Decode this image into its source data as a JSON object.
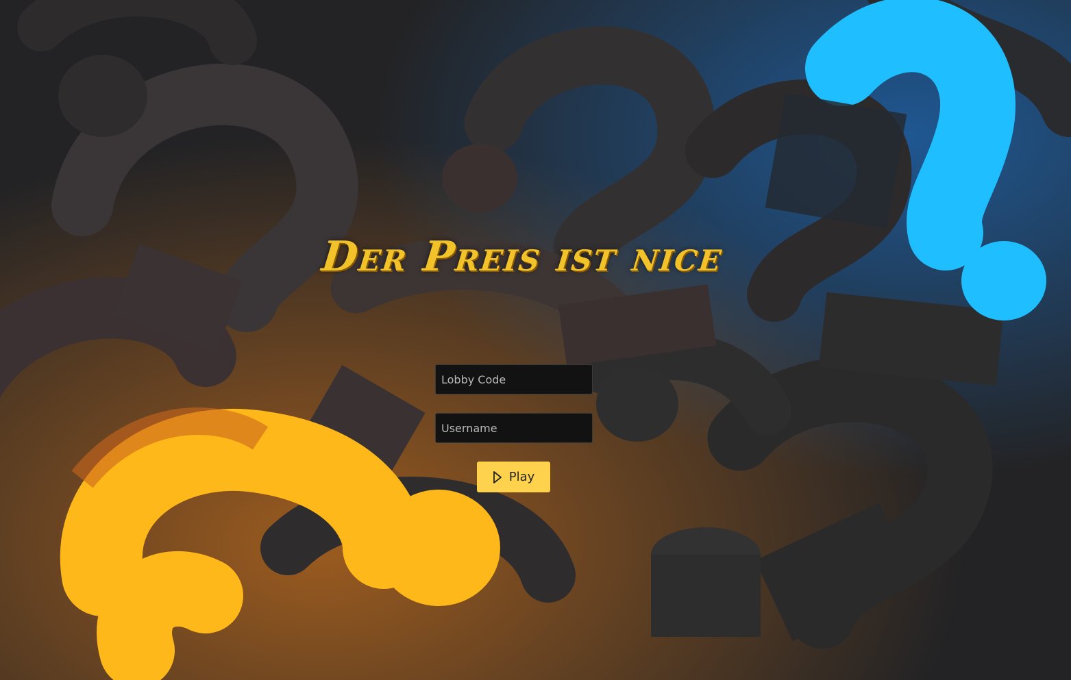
{
  "title": "Der Preis ist nice",
  "form": {
    "lobby_code_placeholder": "Lobby Code",
    "username_placeholder": "Username",
    "play_label": "Play",
    "play_icon": "play-icon"
  },
  "colors": {
    "title": "#f2c22b",
    "play_button": "#ffd24d",
    "input_background": "#121212",
    "accent_orange": "#ffb81a",
    "accent_blue": "#1fbfff"
  }
}
